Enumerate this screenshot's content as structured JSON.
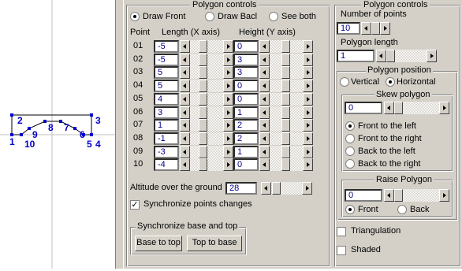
{
  "canvas": {
    "point_labels": [
      "1",
      "2",
      "3",
      "4",
      "5",
      "6",
      "7",
      "8",
      "9",
      "10"
    ]
  },
  "left_panel": {
    "title": "Polygon controls",
    "view_options": [
      {
        "label": "Draw Front",
        "selected": true
      },
      {
        "label": "Draw Bacl",
        "selected": false
      },
      {
        "label": "See both",
        "selected": false
      }
    ],
    "table_headers": {
      "point": "Point",
      "length": "Length (X axis)",
      "height": "Height (Y axis)"
    },
    "rows": [
      {
        "point": "01",
        "length": "-5",
        "height": "0"
      },
      {
        "point": "02",
        "length": "-5",
        "height": "3"
      },
      {
        "point": "03",
        "length": "5",
        "height": "3"
      },
      {
        "point": "04",
        "length": "5",
        "height": "0"
      },
      {
        "point": "05",
        "length": "4",
        "height": "0"
      },
      {
        "point": "06",
        "length": "3",
        "height": "1"
      },
      {
        "point": "07",
        "length": "1",
        "height": "2"
      },
      {
        "point": "08",
        "length": "-1",
        "height": "2"
      },
      {
        "point": "09",
        "length": "-3",
        "height": "1"
      },
      {
        "point": "10",
        "length": "-4",
        "height": "0"
      }
    ],
    "altitude_label": "Altitude over the ground",
    "altitude_value": "28",
    "sync_points_label": "Synchronize points changes",
    "sync_points_checked": true,
    "sync_group_title": "Synchronize base and top",
    "base_to_top_label": "Base to top",
    "top_to_base_label": "Top to base"
  },
  "right_panel": {
    "title": "Polygon controls",
    "num_points_label": "Number of points",
    "num_points_value": "10",
    "polygon_length_label": "Polygon  length",
    "polygon_length_value": "1",
    "position_title": "Polygon position",
    "position_options": [
      {
        "label": "Vertical",
        "selected": false
      },
      {
        "label": "Horizontal",
        "selected": true
      }
    ],
    "skew_title": "Skew polygon",
    "skew_value": "0",
    "skew_options": [
      {
        "label": "Front  to the left",
        "selected": true
      },
      {
        "label": "Front to the right",
        "selected": false
      },
      {
        "label": "Back to the left",
        "selected": false
      },
      {
        "label": "Back to the right",
        "selected": false
      }
    ],
    "raise_title": "Raise Polygon",
    "raise_value": "0",
    "raise_options": [
      {
        "label": "Front",
        "selected": true
      },
      {
        "label": "Back",
        "selected": false
      }
    ],
    "triangulation_label": "Triangulation",
    "triangulation_checked": false,
    "shaded_label": "Shaded",
    "shaded_checked": false
  }
}
